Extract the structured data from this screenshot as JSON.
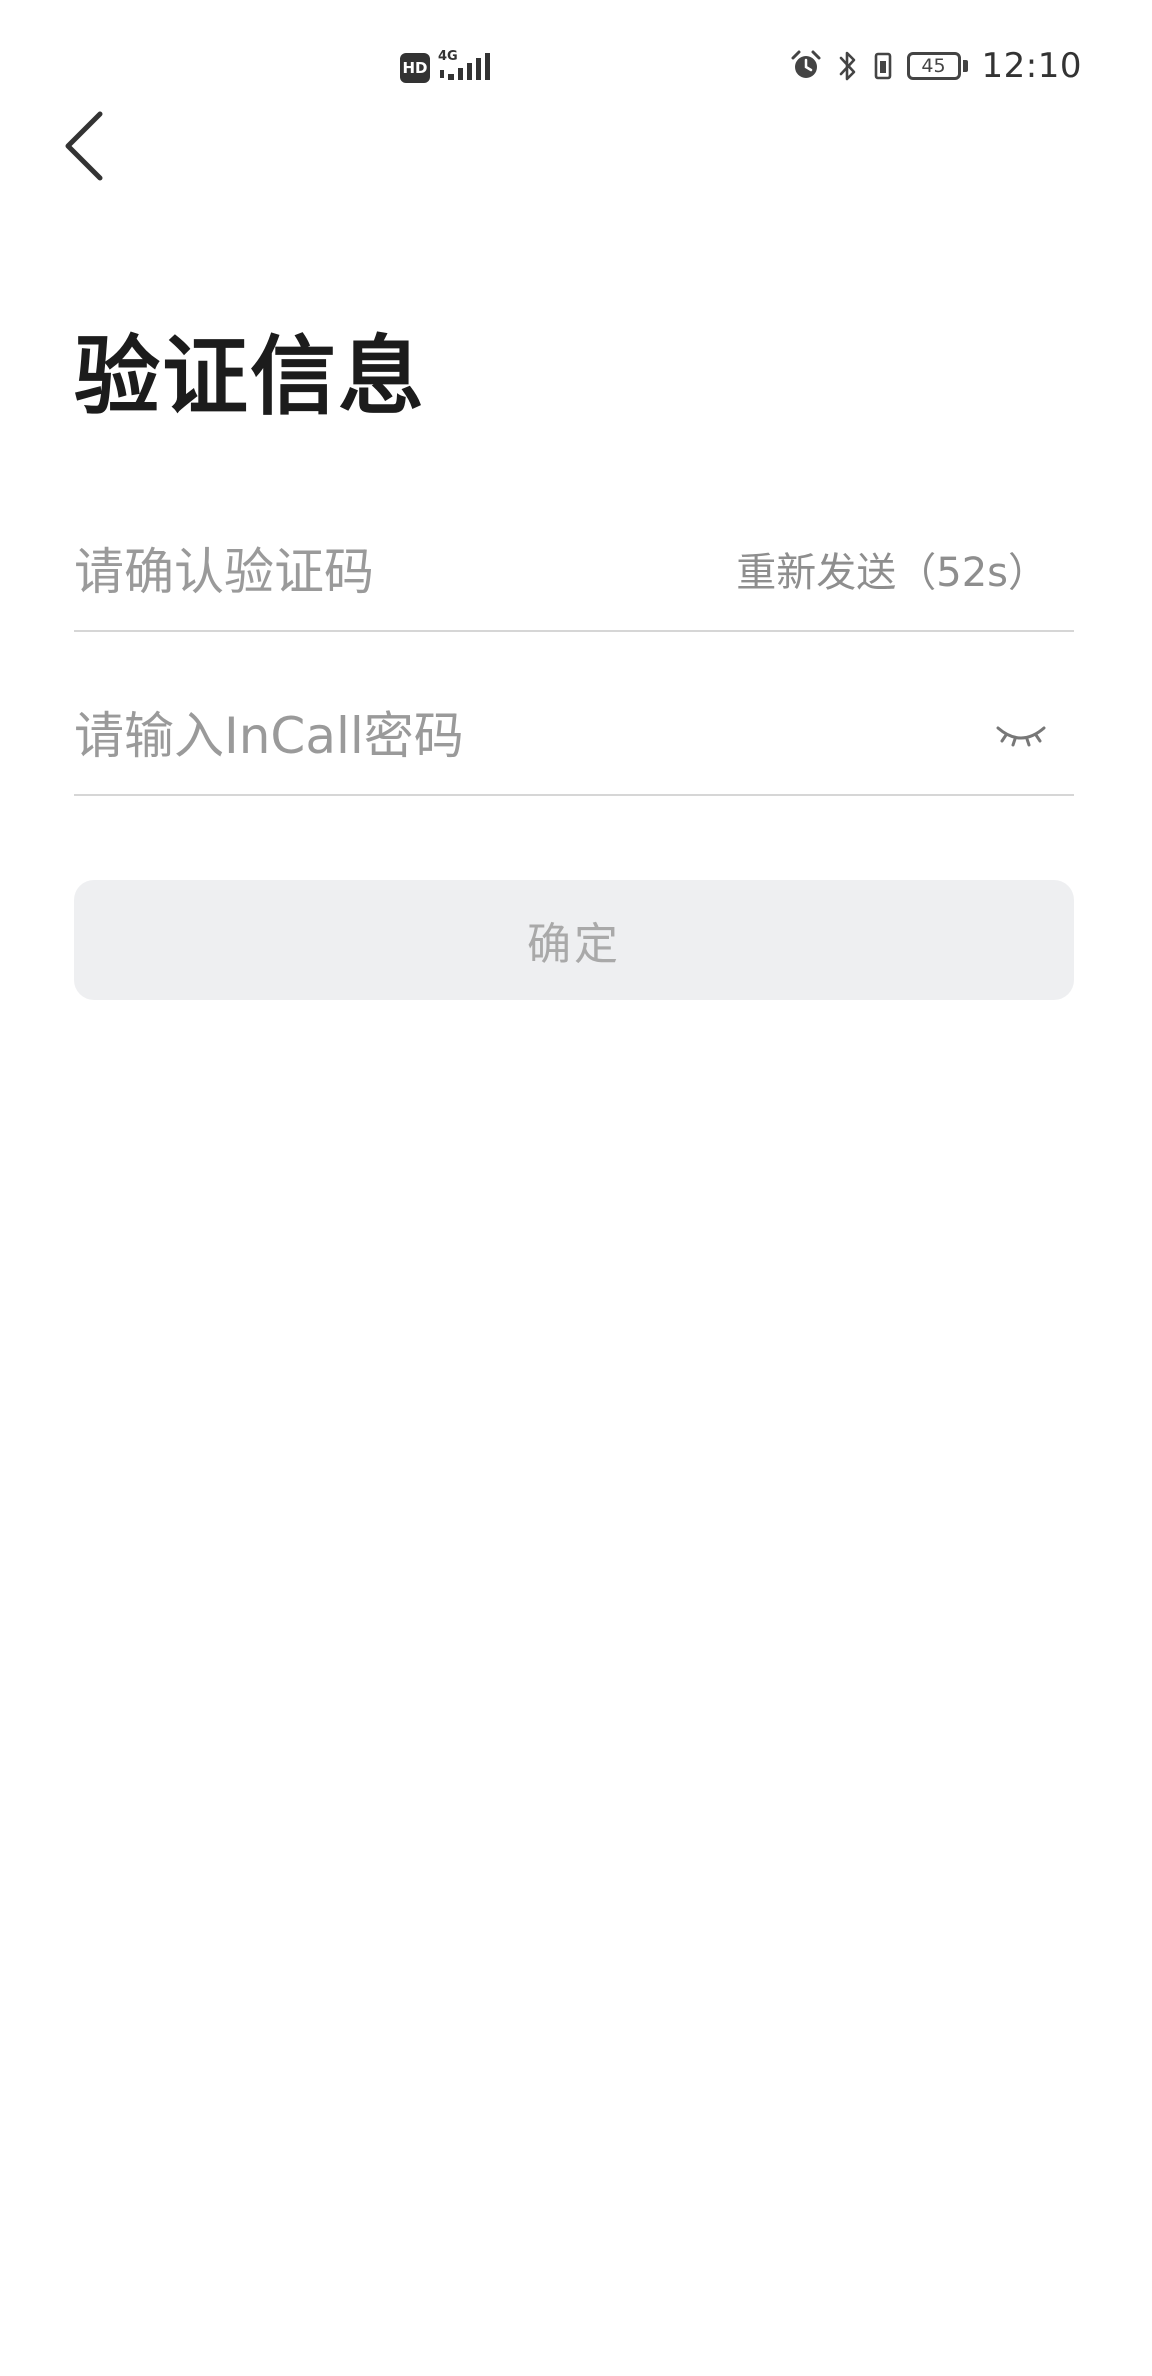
{
  "status_bar": {
    "hd_label": "HD",
    "network_label": "4G",
    "battery_level": "45",
    "time": "12:10",
    "icons": [
      "hd-icon",
      "signal-icon",
      "alarm-icon",
      "bluetooth-icon",
      "vibrate-icon",
      "battery-icon"
    ]
  },
  "header": {
    "back_icon": "chevron-left-icon"
  },
  "page": {
    "title": "验证信息"
  },
  "form": {
    "code_field": {
      "placeholder": "请确认验证码",
      "value": "",
      "resend_label": "重新发送（52s）"
    },
    "password_field": {
      "placeholder": "请输入InCall密码",
      "value": "",
      "toggle_icon": "eye-closed-icon"
    },
    "confirm_label": "确定"
  },
  "colors": {
    "title": "#1c1c1c",
    "placeholder": "#9a9a9a",
    "divider": "#d6d6d6",
    "button_bg": "#eeeff1",
    "button_text": "#a9a9a9"
  }
}
